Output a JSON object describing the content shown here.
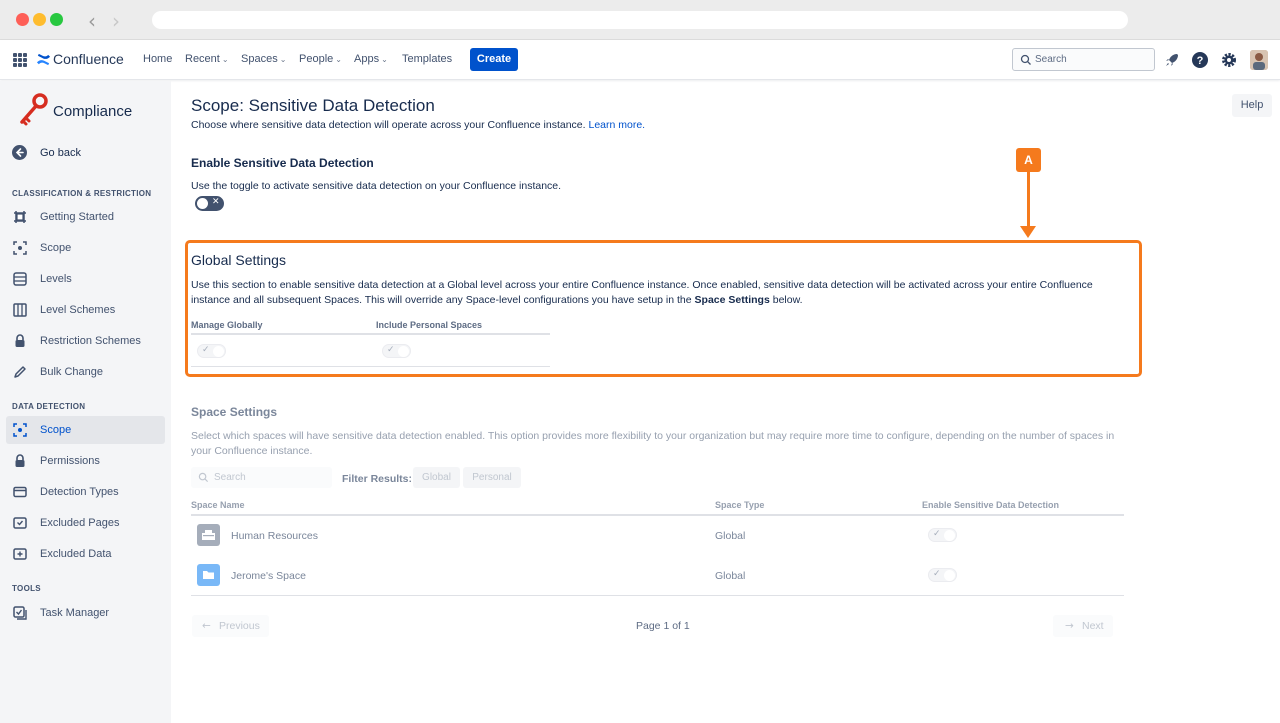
{
  "topnav": {
    "brand": "Confluence",
    "items": [
      {
        "label": "Home",
        "caret": ""
      },
      {
        "label": "Recent",
        "caret": "⌄"
      },
      {
        "label": "Spaces",
        "caret": "⌄"
      },
      {
        "label": "People",
        "caret": "⌄"
      },
      {
        "label": "Apps",
        "caret": "⌄"
      },
      {
        "label": "Templates",
        "caret": ""
      }
    ],
    "create_label": "Create",
    "search_placeholder": "Search",
    "icons": [
      "app-switcher-icon",
      "confluence-logo-icon",
      "notifications-rocket-icon",
      "help-icon",
      "settings-gear-icon",
      "user-avatar"
    ]
  },
  "sidebar": {
    "app_title": "Compliance",
    "go_back": "Go back",
    "sections": [
      {
        "title": "CLASSIFICATION & RESTRICTION",
        "items": [
          {
            "label": "Getting Started",
            "icon": "flag-icon"
          },
          {
            "label": "Scope",
            "icon": "scope-icon"
          },
          {
            "label": "Levels",
            "icon": "levels-icon"
          },
          {
            "label": "Level Schemes",
            "icon": "level-schemes-icon"
          },
          {
            "label": "Restriction Schemes",
            "icon": "lock-icon"
          },
          {
            "label": "Bulk Change",
            "icon": "pencil-icon"
          }
        ]
      },
      {
        "title": "DATA DETECTION",
        "items": [
          {
            "label": "Scope",
            "icon": "scope-icon",
            "active": true
          },
          {
            "label": "Permissions",
            "icon": "lock-icon"
          },
          {
            "label": "Detection Types",
            "icon": "card-icon"
          },
          {
            "label": "Excluded Pages",
            "icon": "excluded-pages-icon"
          },
          {
            "label": "Excluded Data",
            "icon": "excluded-data-icon"
          }
        ]
      },
      {
        "title": "TOOLS",
        "items": [
          {
            "label": "Task Manager",
            "icon": "task-manager-icon"
          }
        ]
      }
    ]
  },
  "main": {
    "help_label": "Help",
    "title": "Scope: Sensitive Data Detection",
    "description": "Choose where sensitive data detection will operate across your Confluence instance.",
    "learn_more": "Learn more.",
    "enable": {
      "title": "Enable Sensitive Data Detection",
      "description": "Use the toggle to activate sensitive data detection on your Confluence instance.",
      "toggle_on": false
    },
    "annotation_label": "A",
    "global": {
      "title": "Global Settings",
      "description_part1": "Use this section to enable sensitive data detection at a Global level across your entire Confluence instance. Once enabled, sensitive data detection will be activated across your entire Confluence instance and all subsequent Spaces. This will override any Space-level configurations you have setup in the ",
      "description_bold": "Space Settings",
      "description_part2": " below.",
      "columns": [
        "Manage Globally",
        "Include Personal Spaces"
      ]
    },
    "spaces": {
      "title": "Space Settings",
      "description": "Select which spaces will have sensitive data detection enabled. This option provides more flexibility to your organization but may require more time to configure, depending on the number of spaces in your Confluence instance.",
      "search_placeholder": "Search",
      "filter_label": "Filter Results:",
      "filters": [
        "Global",
        "Personal"
      ],
      "columns": [
        "Space Name",
        "Space Type",
        "Enable Sensitive Data Detection"
      ],
      "rows": [
        {
          "name": "Human Resources",
          "type": "Global",
          "icon_color": "#a5adba"
        },
        {
          "name": "Jerome's Space",
          "type": "Global",
          "icon_color": "#79b8f7"
        }
      ],
      "previous": "Previous",
      "next": "Next",
      "page_info": "Page 1 of 1"
    },
    "colors": {
      "accent": "#0052cc",
      "annotation": "#f57a1d"
    }
  }
}
